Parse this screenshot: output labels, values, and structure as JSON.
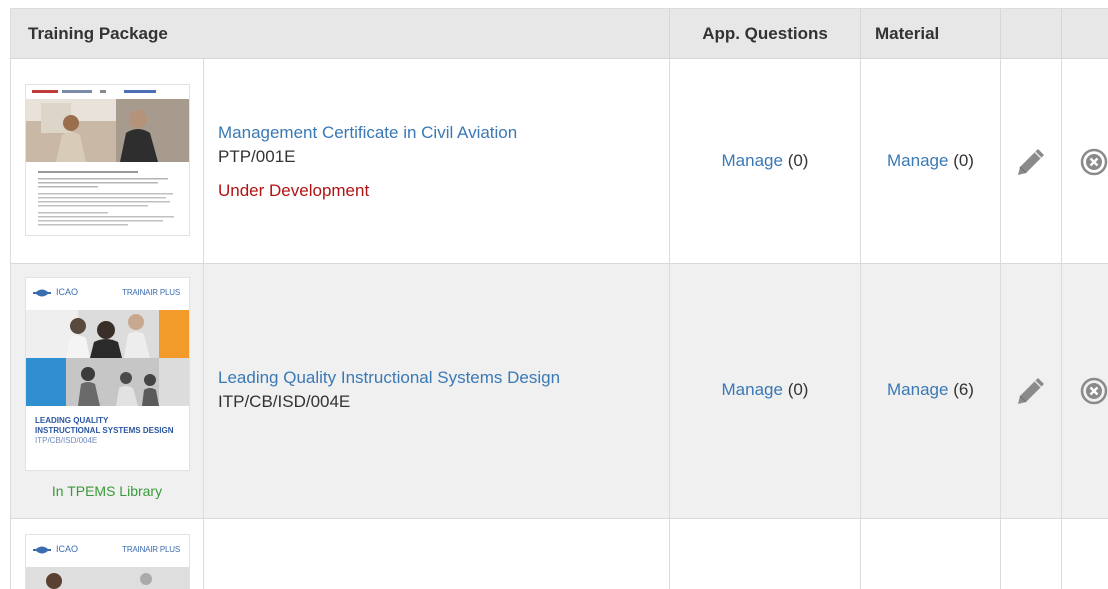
{
  "table": {
    "headers": {
      "package": "Training Package",
      "app_questions": "App. Questions",
      "material": "Material"
    },
    "rows": [
      {
        "title": "Management Certificate in Civil Aviation",
        "code": "PTP/001E",
        "status": "Under Development",
        "status_color": "#b01414",
        "app_questions_link": "Manage",
        "app_questions_count": "(0)",
        "material_link": "Manage",
        "material_count": "(0)"
      },
      {
        "title": "Leading Quality Instructional Systems Design",
        "code": "ITP/CB/ISD/004E",
        "thumb_brand_left": "ICAO",
        "thumb_brand_right": "TRAINAIR PLUS",
        "thumb_caption_line1": "LEADING QUALITY",
        "thumb_caption_line2": "INSTRUCTIONAL SYSTEMS DESIGN",
        "thumb_caption_code": "ITP/CB/ISD/004E",
        "library_status": "In TPEMS Library",
        "library_status_color": "#3a9a3a",
        "app_questions_link": "Manage",
        "app_questions_count": "(0)",
        "material_link": "Manage",
        "material_count": "(6)"
      },
      {
        "thumb_brand_left": "ICAO",
        "thumb_brand_right": "TRAINAIR PLUS"
      }
    ]
  },
  "icons": {
    "edit": "pencil-icon",
    "delete": "circle-x-icon"
  },
  "colors": {
    "link": "#3a79b5",
    "header_bg": "#e7e7e7",
    "alt_row_bg": "#f0f0f0"
  }
}
